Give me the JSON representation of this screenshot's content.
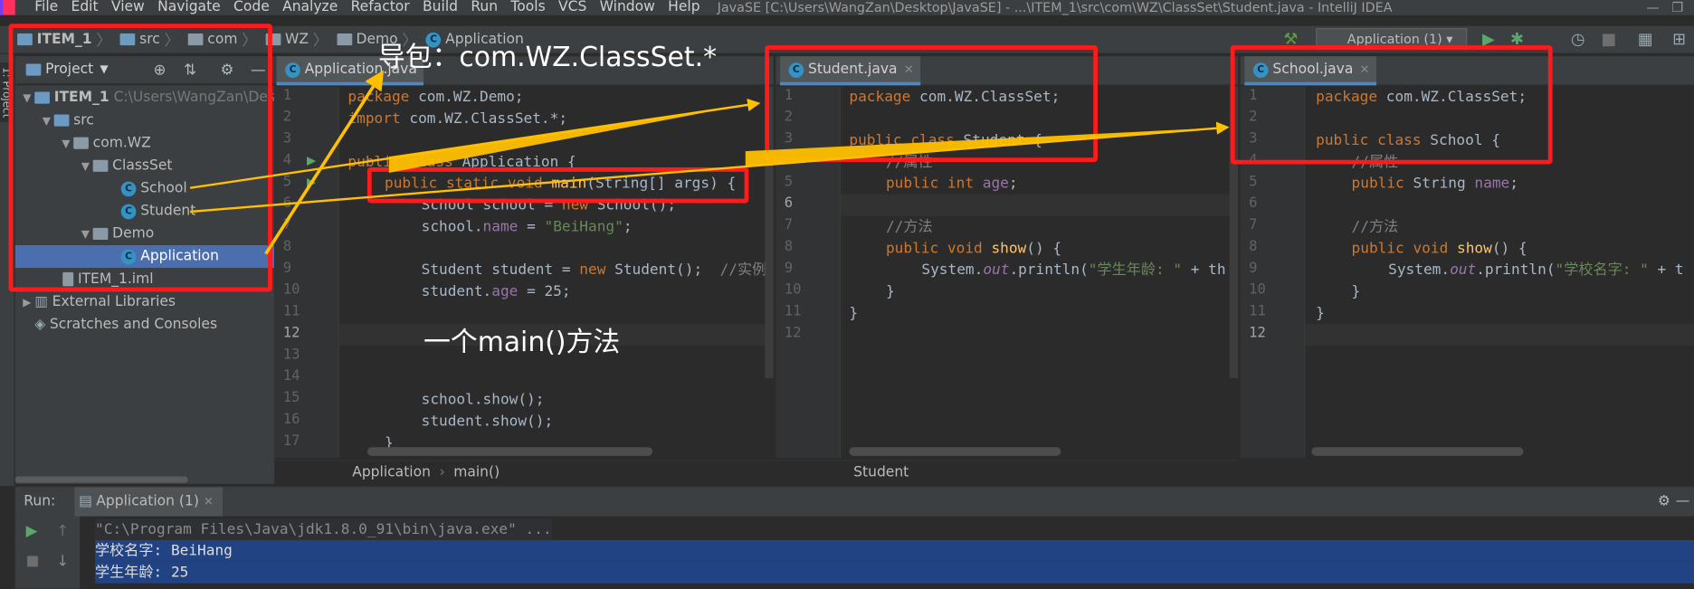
{
  "menubar": {
    "items": [
      "File",
      "Edit",
      "View",
      "Navigate",
      "Code",
      "Analyze",
      "Refactor",
      "Build",
      "Run",
      "Tools",
      "VCS",
      "Window",
      "Help"
    ],
    "title": "JavaSE [C:\\Users\\WangZan\\Desktop\\JavaSE] - ...\\ITEM_1\\src\\com\\WZ\\ClassSet\\Student.java - IntelliJ IDEA"
  },
  "navbar": {
    "crumbs": [
      "ITEM_1",
      "src",
      "com",
      "WZ",
      "Demo",
      "Application"
    ],
    "run_config": "Application (1)"
  },
  "project": {
    "header": "Project",
    "side_tab": "1: Project",
    "tree": [
      {
        "label": "ITEM_1",
        "hint": "C:\\Users\\WangZan\\Desk"
      },
      {
        "label": "src"
      },
      {
        "label": "com.WZ"
      },
      {
        "label": "ClassSet"
      },
      {
        "label": "School"
      },
      {
        "label": "Student"
      },
      {
        "label": "Demo"
      },
      {
        "label": "Application"
      },
      {
        "label": "ITEM_1.iml"
      },
      {
        "label": "External Libraries"
      },
      {
        "label": "Scratches and Consoles"
      }
    ]
  },
  "editors": [
    {
      "tab": "Application.java",
      "current_line": "12",
      "lines": [
        "1",
        "2",
        "3",
        "4",
        "5",
        "6",
        "7",
        "8",
        "9",
        "10",
        "11",
        "12",
        "13",
        "14",
        "15",
        "16",
        "17"
      ],
      "breadcrumb": [
        "Application",
        "main()"
      ],
      "code": {
        "l1_kw": "package",
        "l1_rest": " com.WZ.Demo;",
        "l2_kw": "import",
        "l2_rest": " com.WZ.ClassSet.*;",
        "l4_kw": "public class",
        "l4_rest": " Application {",
        "l5_kw": "public static void",
        "l5_fn": "main",
        "l5_rest": "(String[] args) {",
        "l6_a": "School school = ",
        "l6_kw": "new",
        "l6_b": " School();",
        "l7_a": "school.",
        "l7_fld": "name",
        "l7_b": " = ",
        "l7_str": "\"BeiHang\"",
        "l7_c": ";",
        "l9_a": "Student student = ",
        "l9_kw": "new",
        "l9_b": " Student();  ",
        "l9_cm": "//实例",
        "l10_a": "student.",
        "l10_fld": "age",
        "l10_b": " = 25;",
        "l15": "school.show();",
        "l16": "student.show();",
        "l17": "}"
      }
    },
    {
      "tab": "Student.java",
      "current_line": "6",
      "lines": [
        "1",
        "2",
        "3",
        "4",
        "5",
        "6",
        "7",
        "8",
        "9",
        "10",
        "11",
        "12"
      ],
      "breadcrumb": [
        "Student"
      ],
      "code": {
        "l1_kw": "package",
        "l1_rest": " com.WZ.ClassSet;",
        "l3_kw": "public class",
        "l3_rest": " Student {",
        "l4_cm": "//属性",
        "l5_kw": "public int",
        "l5_fld": "age",
        "l5_rest": ";",
        "l7_cm": "//方法",
        "l8_kw": "public void",
        "l8_fn": "show",
        "l8_rest": "() {",
        "l9_a": "System.",
        "l9_it": "out",
        "l9_b": ".println(",
        "l9_str": "\"学生年龄: \"",
        "l9_c": " + th",
        "l10": "}",
        "l11": "}"
      }
    },
    {
      "tab": "School.java",
      "current_line": "12",
      "lines": [
        "1",
        "2",
        "3",
        "4",
        "5",
        "6",
        "7",
        "8",
        "9",
        "10",
        "11",
        "12"
      ],
      "code": {
        "l1_kw": "package",
        "l1_rest": " com.WZ.ClassSet;",
        "l3_kw": "public class",
        "l3_rest": " School {",
        "l4_cm": "//属性",
        "l5_kw": "public",
        "l5_a": " String ",
        "l5_fld": "name",
        "l5_rest": ";",
        "l7_cm": "//方法",
        "l8_kw": "public void",
        "l8_fn": "show",
        "l8_rest": "() {",
        "l9_a": "System.",
        "l9_it": "out",
        "l9_b": ".println(",
        "l9_str": "\"学校名字: \"",
        "l9_c": " + t",
        "l10": "}",
        "l11": "}"
      }
    }
  ],
  "run": {
    "label": "Run:",
    "tab": "Application (1)",
    "output": [
      "\"C:\\Program Files\\Java\\jdk1.8.0_91\\bin\\java.exe\" ...",
      "学校名字: BeiHang",
      "学生年龄: 25"
    ]
  },
  "annotations": {
    "import_note": "导包：com.WZ.ClassSet.*",
    "main_note": "一个main()方法",
    "color": "#ff1b1b",
    "arrow_color": "#ffc000"
  }
}
